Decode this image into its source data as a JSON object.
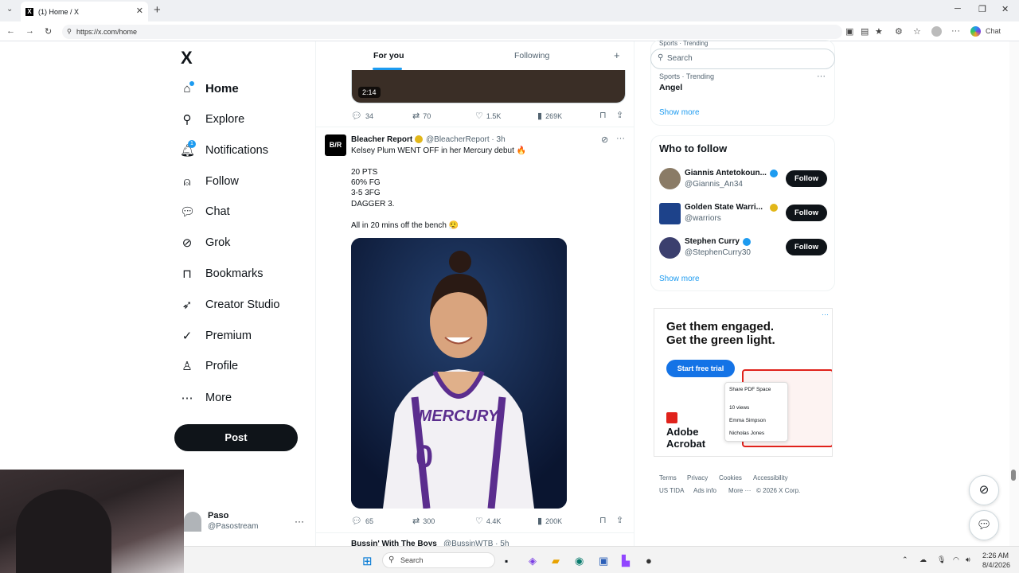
{
  "browser": {
    "tab_title": "(1) Home / X",
    "url": "https://x.com/home",
    "chat_label": "Chat"
  },
  "nav": {
    "logo": "X",
    "items": [
      {
        "label": "Home",
        "icon": "home-icon"
      },
      {
        "label": "Explore",
        "icon": "search-icon"
      },
      {
        "label": "Notifications",
        "icon": "bell-icon"
      },
      {
        "label": "Follow",
        "icon": "person-add-icon"
      },
      {
        "label": "Chat",
        "icon": "chat-bubble-icon"
      },
      {
        "label": "Grok",
        "icon": "grok-icon"
      },
      {
        "label": "Bookmarks",
        "icon": "bookmark-icon"
      },
      {
        "label": "Creator Studio",
        "icon": "rocket-icon"
      },
      {
        "label": "Premium",
        "icon": "verified-icon"
      },
      {
        "label": "Profile",
        "icon": "person-icon"
      },
      {
        "label": "More",
        "icon": "more-circle-icon"
      }
    ],
    "notification_badge": "1",
    "post_label": "Post"
  },
  "account": {
    "name": "Paso",
    "handle": "@Pasostream"
  },
  "feed": {
    "tabs": {
      "for_you": "For you",
      "following": "Following"
    },
    "video_tweet": {
      "duration": "2:14",
      "replies": "34",
      "reposts": "70",
      "likes": "1.5K",
      "views": "269K"
    },
    "tweet": {
      "avatar_text": "B/R",
      "name": "Bleacher Report",
      "handle": "@BleacherReport · 3h",
      "lines": [
        "Kelsey Plum WENT OFF in her Mercury debut 🔥",
        "20 PTS",
        "60% FG",
        "3-5 3FG",
        "DAGGER 3.",
        "All in 20 mins off the bench 😮‍💨"
      ],
      "jersey_text": "MERCURY",
      "jersey_number": "0",
      "replies": "65",
      "reposts": "300",
      "likes": "4.4K",
      "views": "200K"
    },
    "next_tweet": {
      "name": "Bussin' With The Boys",
      "handle": "@BussinWTB · 5h"
    }
  },
  "sidebar": {
    "search_placeholder": "Search",
    "trend_cut": "Sports · Trending",
    "trend": {
      "category": "Sports · Trending",
      "name": "Angel"
    },
    "show_more": "Show more",
    "who_to_follow_title": "Who to follow",
    "suggestions": [
      {
        "name": "Giannis Antetokoun...",
        "handle": "@Giannis_An34",
        "badge_color": "#1d9bf0"
      },
      {
        "name": "Golden State Warri...",
        "handle": "@warriors",
        "badge_color": "#e2b719"
      },
      {
        "name": "Stephen Curry",
        "handle": "@StephenCurry30",
        "badge_color": "#1d9bf0"
      }
    ],
    "follow_label": "Follow",
    "ad": {
      "headline_1": "Get them engaged.",
      "headline_2": "Get the green light.",
      "cta": "Start free trial",
      "brand_1": "Adobe",
      "brand_2": "Acrobat",
      "card_title": "Share PDF Space",
      "card_views": "10 views",
      "card_person_1": "Emma Simpson",
      "card_person_2": "Nicholas Jones"
    },
    "footer": [
      "Terms",
      "Privacy",
      "Cookies",
      "Accessibility",
      "US TIDA",
      "Ads info",
      "More ···",
      "© 2026 X Corp."
    ]
  },
  "taskbar": {
    "search": "Search",
    "time": "2:26 AM",
    "date": "8/4/2026"
  },
  "colors": {
    "accent": "#1d9bf0",
    "verified_gold": "#e2b719",
    "adobe_red": "#e0221b"
  }
}
